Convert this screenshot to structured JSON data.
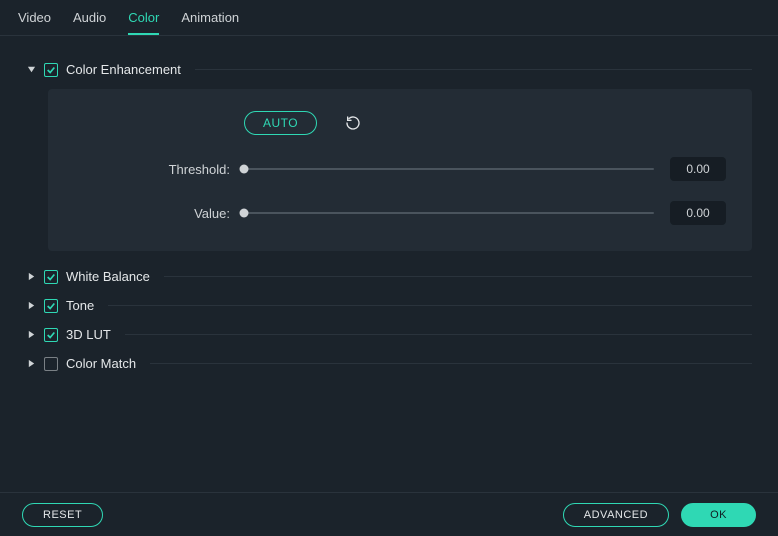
{
  "tabs": {
    "video": "Video",
    "audio": "Audio",
    "color": "Color",
    "animation": "Animation"
  },
  "sections": {
    "color_enhancement": {
      "label": "Color Enhancement"
    },
    "white_balance": {
      "label": "White Balance"
    },
    "tone": {
      "label": "Tone"
    },
    "lut": {
      "label": "3D LUT"
    },
    "color_match": {
      "label": "Color Match"
    }
  },
  "panel": {
    "auto_label": "AUTO",
    "threshold_label": "Threshold:",
    "threshold_value": "0.00",
    "value_label": "Value:",
    "value_value": "0.00"
  },
  "footer": {
    "reset": "RESET",
    "advanced": "ADVANCED",
    "ok": "OK"
  }
}
